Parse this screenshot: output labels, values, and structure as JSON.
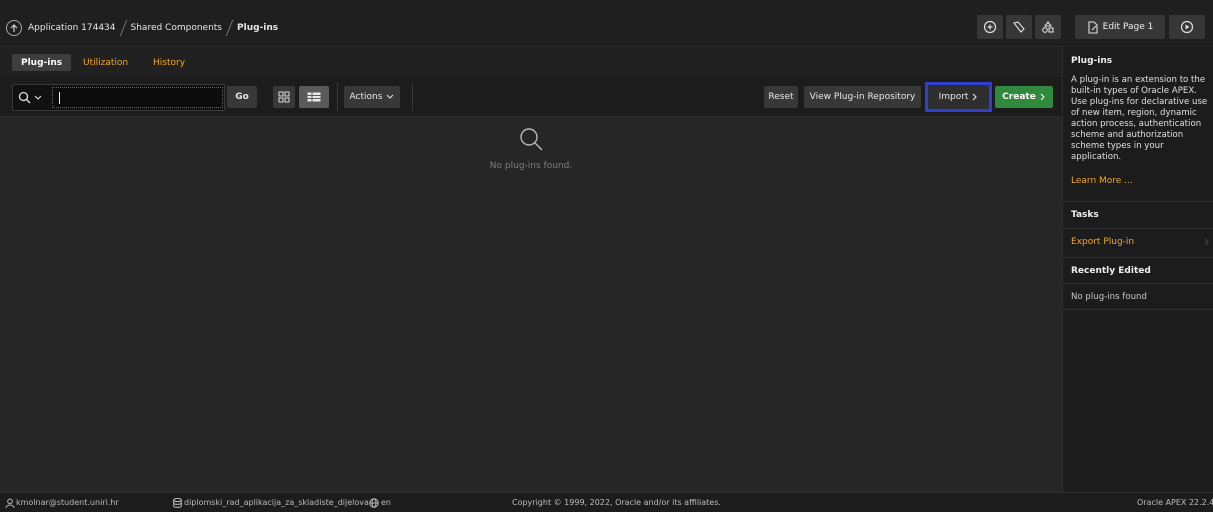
{
  "breadcrumb": {
    "app": "Application 174434",
    "section": "Shared Components",
    "current": "Plug-ins"
  },
  "header": {
    "edit_page": "Edit Page 1",
    "icons": [
      "comment-plus-icon",
      "pencil-ruler-icon",
      "shapes-icon",
      "edit-page-icon",
      "run-icon"
    ]
  },
  "tabs": [
    {
      "label": "Plug-ins",
      "active": true
    },
    {
      "label": "Utilization",
      "active": false
    },
    {
      "label": "History",
      "active": false
    }
  ],
  "toolbar": {
    "search_value": "",
    "go": "Go",
    "actions": "Actions",
    "reset": "Reset",
    "view_repo": "View Plug-in Repository",
    "import": "Import",
    "create": "Create"
  },
  "empty": {
    "message": "No plug-ins found."
  },
  "sidebar": {
    "title": "Plug-ins",
    "description": "A plug-in is an extension to the built-in types of Oracle APEX. Use plug-ins for declarative use of new item, region, dynamic action process, authentication scheme and authorization scheme types in your application.",
    "learn_more": "Learn More ...",
    "tasks_title": "Tasks",
    "task_export": "Export Plug-in",
    "recent_title": "Recently Edited",
    "recent_none": "No plug-ins found"
  },
  "footer": {
    "user": "kmolnar@student.uniri.hr",
    "workspace": "diplomski_rad_aplikacija_za_skladiste_dijelova",
    "lang": "en",
    "copyright": "Copyright © 1999, 2022, Oracle and/or its affiliates.",
    "version": "Oracle APEX 22.2.4"
  },
  "colors": {
    "accent_link": "#f5a623",
    "create_green": "#2f8a3e",
    "import_highlight": "#2f3fd0"
  }
}
